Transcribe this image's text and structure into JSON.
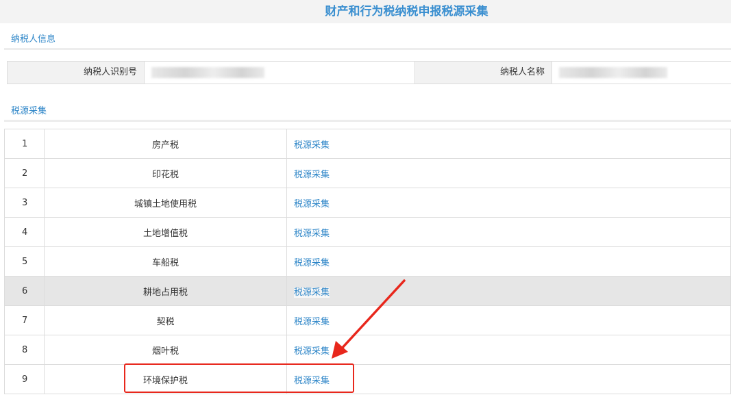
{
  "page": {
    "title": "财产和行为税纳税申报税源采集"
  },
  "taxpayer_section": {
    "tab_label": "纳税人信息",
    "id_label": "纳税人识别号",
    "id_value": "",
    "name_label": "纳税人名称",
    "name_value": ""
  },
  "source_section": {
    "tab_label": "税源采集",
    "rows": [
      {
        "num": "1",
        "name": "房产税",
        "action": "税源采集"
      },
      {
        "num": "2",
        "name": "印花税",
        "action": "税源采集"
      },
      {
        "num": "3",
        "name": "城镇土地使用税",
        "action": "税源采集"
      },
      {
        "num": "4",
        "name": "土地增值税",
        "action": "税源采集"
      },
      {
        "num": "5",
        "name": "车船税",
        "action": "税源采集"
      },
      {
        "num": "6",
        "name": "耕地占用税",
        "action": "税源采集"
      },
      {
        "num": "7",
        "name": "契税",
        "action": "税源采集"
      },
      {
        "num": "8",
        "name": "烟叶税",
        "action": "税源采集"
      },
      {
        "num": "9",
        "name": "环境保护税",
        "action": "税源采集"
      }
    ],
    "highlighted_row": "6"
  },
  "annotation": {
    "color": "#e8271c",
    "target_row": "9"
  },
  "colors": {
    "accent": "#2e86c8",
    "title": "#3a8fd0",
    "annotation": "#e8271c"
  }
}
